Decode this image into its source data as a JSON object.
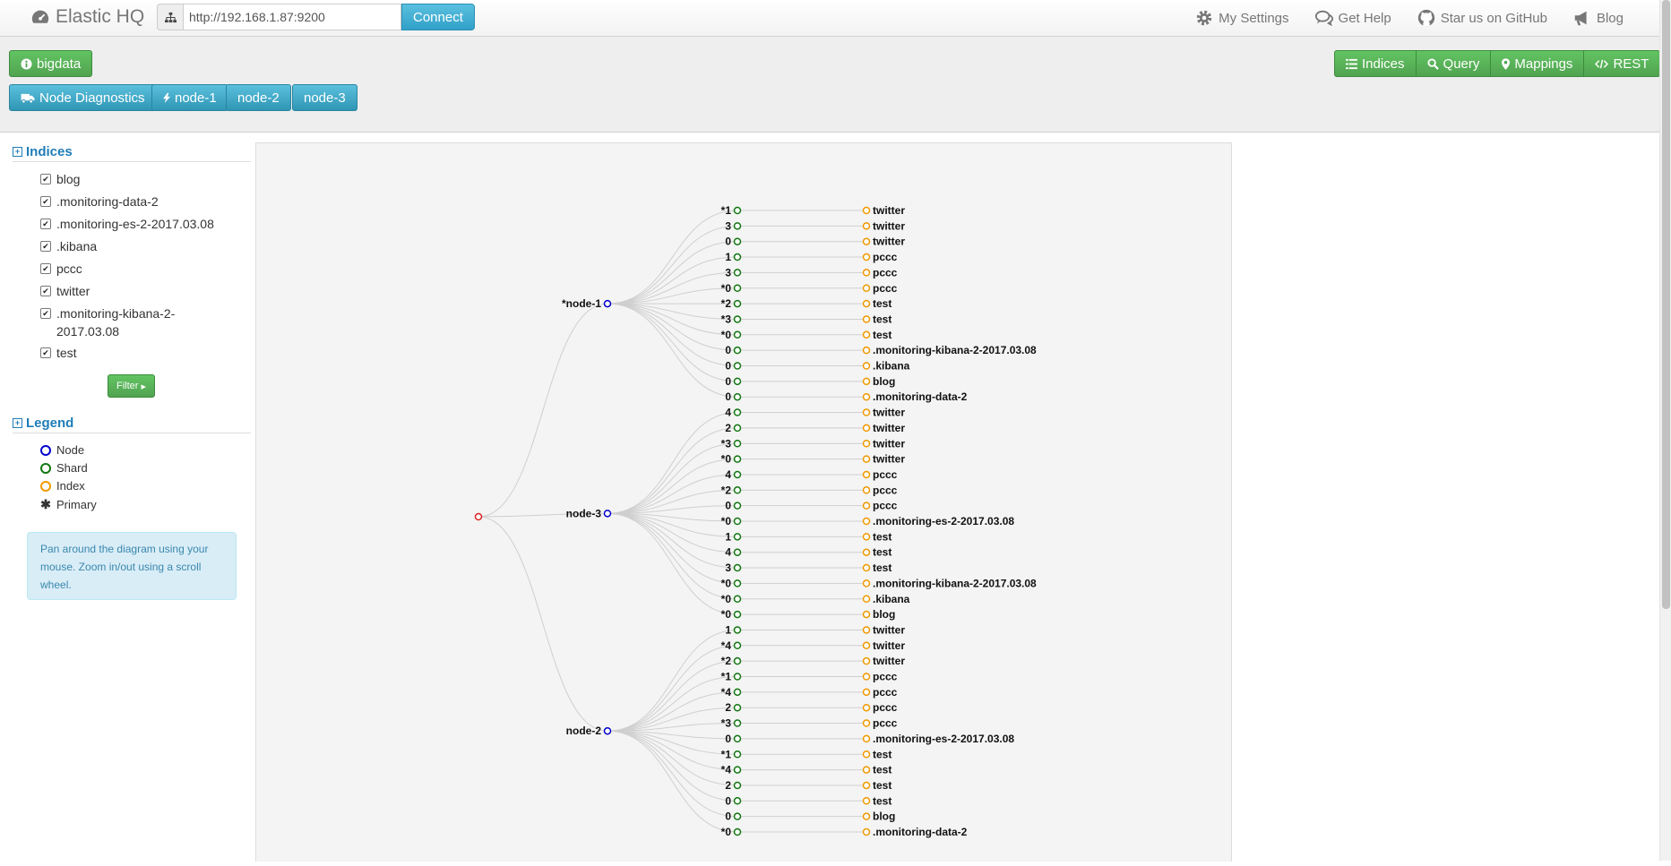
{
  "navbar": {
    "brand": "Elastic HQ",
    "url_value": "http://192.168.1.87:9200",
    "connect_label": "Connect",
    "links": [
      "My Settings",
      "Get Help",
      "Star us on GitHub",
      "Blog"
    ]
  },
  "header": {
    "cluster_button": "bigdata",
    "node_diagnostics": "Node Diagnostics",
    "node_buttons": [
      "node-1",
      "node-2",
      "node-3"
    ],
    "toolbar": [
      "Indices",
      "Query",
      "Mappings",
      "REST"
    ]
  },
  "sidebar": {
    "indices_title": "Indices",
    "indices": [
      "blog",
      ".monitoring-data-2",
      ".monitoring-es-2-2017.03.08",
      ".kibana",
      "pccc",
      "twitter",
      ".monitoring-kibana-2-2017.03.08",
      "test"
    ],
    "filter_label": "Filter",
    "legend_title": "Legend",
    "legend": [
      {
        "label": "Node",
        "color": "#0000cc"
      },
      {
        "label": "Shard",
        "color": "#117711"
      },
      {
        "label": "Index",
        "color": "#ee9900"
      },
      {
        "label": "Primary",
        "color": "#111111"
      }
    ],
    "info": "Pan around the diagram using your mouse. Zoom in/out using a scroll wheel."
  },
  "diagram": {
    "colors": {
      "cluster": "#dd2222",
      "node": "#0000cc",
      "shard": "#117711",
      "index": "#ee9900",
      "link": "#cfcfcf"
    },
    "nodes": [
      {
        "name": "*node-1",
        "shards": [
          [
            "*1",
            "twitter"
          ],
          [
            "3",
            "twitter"
          ],
          [
            "0",
            "twitter"
          ],
          [
            "1",
            "pccc"
          ],
          [
            "3",
            "pccc"
          ],
          [
            "*0",
            "pccc"
          ],
          [
            "*2",
            "test"
          ],
          [
            "*3",
            "test"
          ],
          [
            "*0",
            "test"
          ],
          [
            "0",
            ".monitoring-kibana-2-2017.03.08"
          ],
          [
            "0",
            ".kibana"
          ],
          [
            "0",
            "blog"
          ],
          [
            "0",
            ".monitoring-data-2"
          ]
        ]
      },
      {
        "name": "node-3",
        "shards": [
          [
            "4",
            "twitter"
          ],
          [
            "2",
            "twitter"
          ],
          [
            "*3",
            "twitter"
          ],
          [
            "*0",
            "twitter"
          ],
          [
            "4",
            "pccc"
          ],
          [
            "*2",
            "pccc"
          ],
          [
            "0",
            "pccc"
          ],
          [
            "*0",
            ".monitoring-es-2-2017.03.08"
          ],
          [
            "1",
            "test"
          ],
          [
            "4",
            "test"
          ],
          [
            "3",
            "test"
          ],
          [
            "*0",
            ".monitoring-kibana-2-2017.03.08"
          ],
          [
            "*0",
            ".kibana"
          ],
          [
            "*0",
            "blog"
          ]
        ]
      },
      {
        "name": "node-2",
        "shards": [
          [
            "1",
            "twitter"
          ],
          [
            "*4",
            "twitter"
          ],
          [
            "*2",
            "twitter"
          ],
          [
            "*1",
            "pccc"
          ],
          [
            "*4",
            "pccc"
          ],
          [
            "2",
            "pccc"
          ],
          [
            "*3",
            "pccc"
          ],
          [
            "0",
            ".monitoring-es-2-2017.03.08"
          ],
          [
            "*1",
            "test"
          ],
          [
            "*4",
            "test"
          ],
          [
            "2",
            "test"
          ],
          [
            "0",
            "test"
          ],
          [
            "0",
            "blog"
          ],
          [
            "*0",
            ".monitoring-data-2"
          ]
        ]
      }
    ]
  }
}
